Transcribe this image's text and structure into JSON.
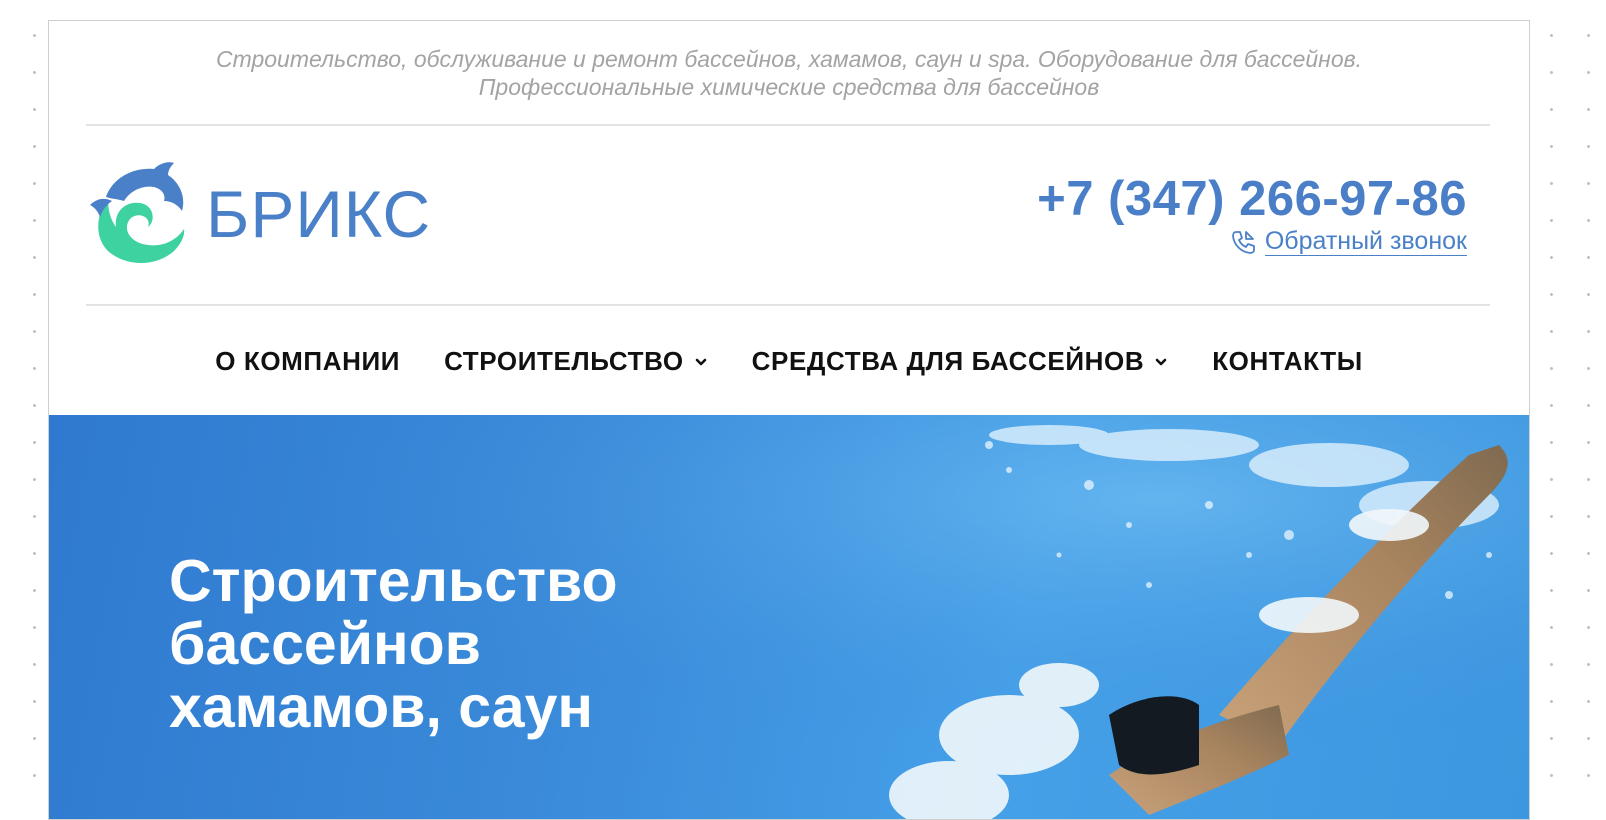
{
  "tagline": "Строительство, обслуживание и ремонт бассейнов, хамамов, саун и spa. Оборудование для бассейнов. Профессиональные химические средства для бассейнов",
  "logo": {
    "text": "БРИКС",
    "icon": "dolphin-wave-logo",
    "colors": {
      "blue": "#4a80c8",
      "green": "#3ed2a0"
    }
  },
  "contact": {
    "phone": "+7 (347) 266-97-86",
    "callback_label": "Обратный звонок",
    "callback_icon": "phone-callback-icon"
  },
  "nav": {
    "items": [
      {
        "label": "О КОМПАНИИ",
        "dropdown": false
      },
      {
        "label": "СТРОИТЕЛЬСТВО",
        "dropdown": true
      },
      {
        "label": "СРЕДСТВА ДЛЯ БАССЕЙНОВ",
        "dropdown": true
      },
      {
        "label": "КОНТАКТЫ",
        "dropdown": false
      }
    ]
  },
  "hero": {
    "title_lines": [
      "Строительство",
      "бассейнов",
      "хамамов, саун"
    ],
    "image": "underwater-swimmer-photo"
  },
  "colors": {
    "accent": "#4a80c8",
    "nav_text": "#111111",
    "tagline": "#a3a3a3",
    "hero_bg": "#3a8ad9"
  }
}
